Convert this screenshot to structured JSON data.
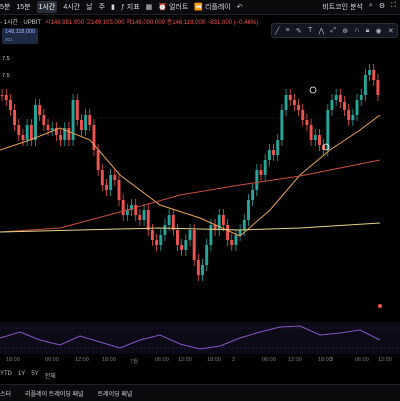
{
  "toolbar": {
    "timeframes": [
      "5분",
      "15분",
      "1시간",
      "4시간",
      "날",
      "주"
    ],
    "active_timeframe": "1시간",
    "indicators_label": "지표",
    "alert_label": "얼러트",
    "replay_label": "리플레이",
    "undo_icon": "undo-icon",
    "chart_name": "비트코인 분석",
    "search_icon": "search-icon",
    "settings_icon": "gear-icon"
  },
  "symbol": {
    "label": "- 1시간 · UPBIT",
    "ohlc": "시148,951,000  고149,103,000  저148,000,000  종148,118,000  −831,000 (−0.46%)",
    "price_tag": "148,118,000",
    "price_tag_sub": "901",
    "ind1": "7.5",
    "ind2": "7.5"
  },
  "drawing_tools": [
    "line-tool-icon",
    "fib-tool-icon",
    "brush-tool-icon",
    "text-tool-icon",
    "pattern-tool-icon",
    "measure-tool-icon",
    "zoom-tool-icon",
    "magnet-tool-icon",
    "lock-tool-icon",
    "eye-tool-icon",
    "trash-tool-icon"
  ],
  "time_axis": [
    "18:00",
    "06:00",
    "12:00",
    "18:00",
    "7월",
    "06:00",
    "12:00",
    "18:00",
    "2",
    "06:00",
    "12:00",
    "18:00",
    "3",
    "06:00",
    "12:00"
  ],
  "range_buttons": [
    "YTD",
    "1Y",
    "5Y",
    "전체"
  ],
  "bottom_tabs": [
    "스터",
    "리플레이 트레이딩 패널",
    "트레이딩 패널"
  ],
  "colors": {
    "up": "#26a69a",
    "down": "#ef5350",
    "ma_fast": "#e8a25a",
    "ma_mid": "#c9513c",
    "ma_slow": "#e6d38a",
    "rsi": "#7e57c2"
  }
}
